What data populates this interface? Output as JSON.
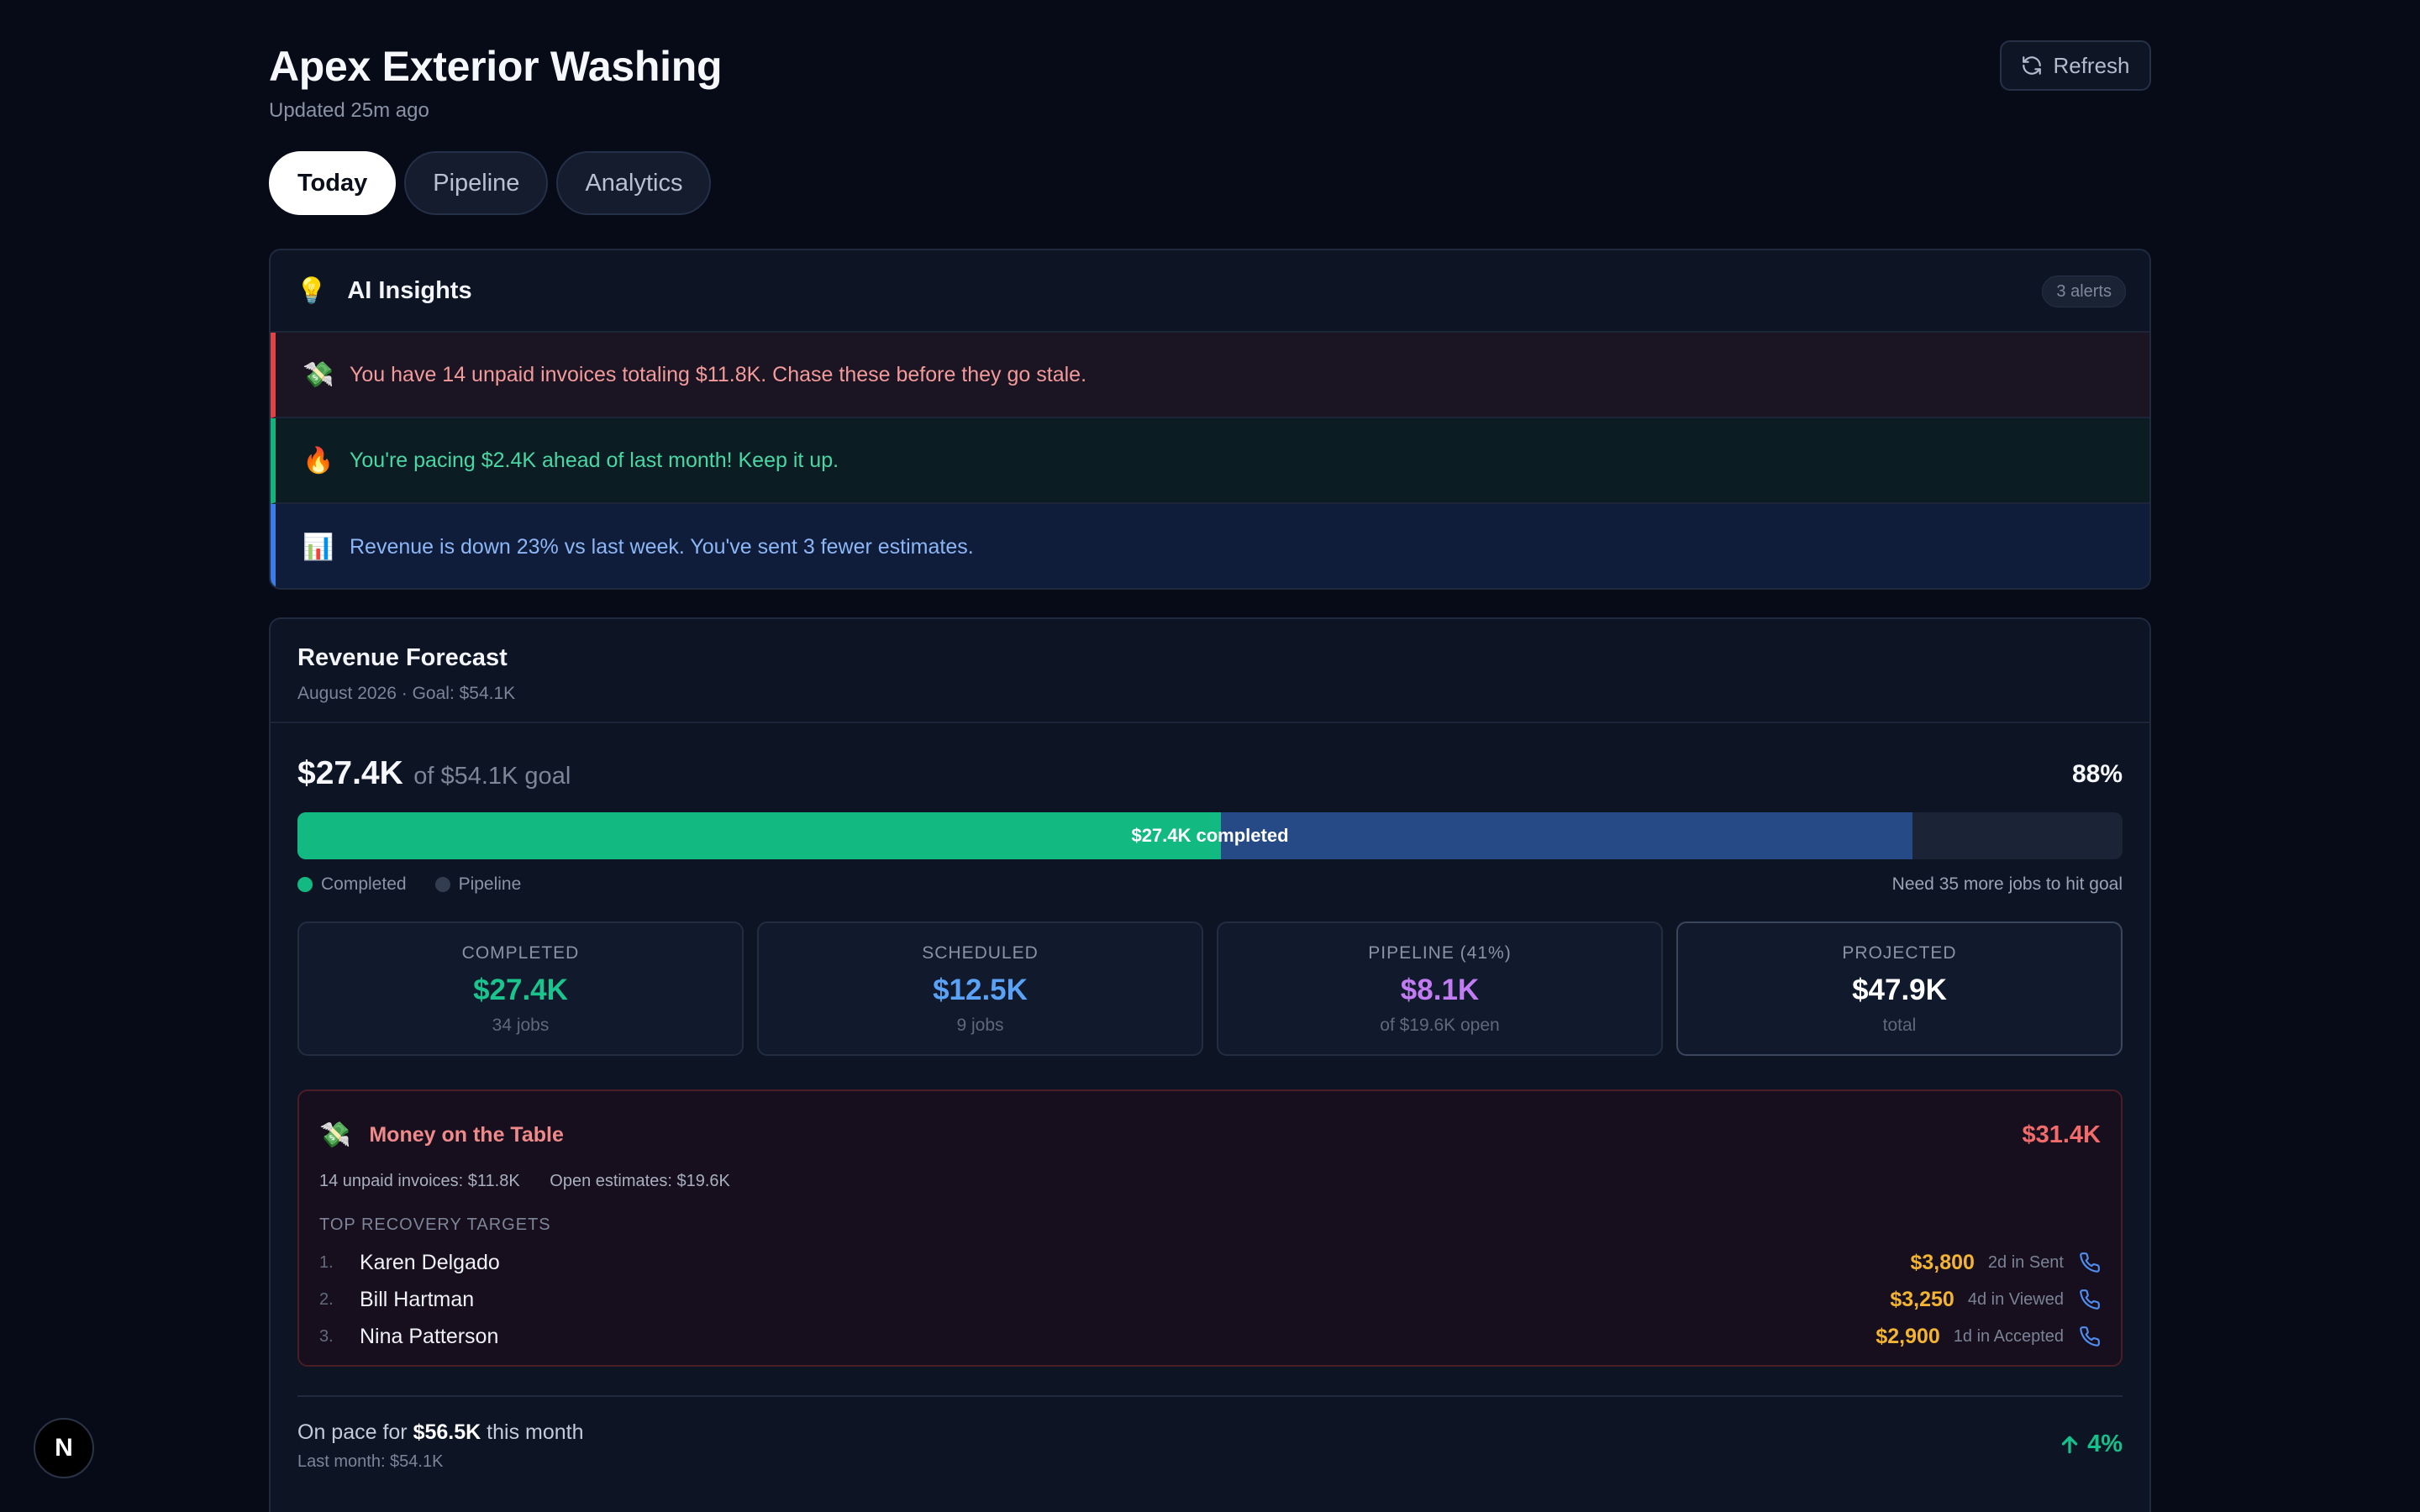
{
  "header": {
    "title": "Apex Exterior Washing",
    "updated": "Updated 25m ago",
    "refresh_label": "Refresh"
  },
  "tabs": [
    {
      "label": "Today",
      "active": true
    },
    {
      "label": "Pipeline",
      "active": false
    },
    {
      "label": "Analytics",
      "active": false
    }
  ],
  "insights": {
    "icon": "lightbulb",
    "title": "AI Insights",
    "badge": "3 alerts",
    "items": [
      {
        "icon": "💸",
        "text": "You have 14 unpaid invoices totaling $11.8K. Chase these before they go stale.",
        "tone": "red"
      },
      {
        "icon": "🔥",
        "text": "You're pacing $2.4K ahead of last month! Keep it up.",
        "tone": "green"
      },
      {
        "icon": "📊",
        "text": "Revenue is down 23% vs last week. You've sent 3 fewer estimates.",
        "tone": "blue"
      }
    ]
  },
  "forecast": {
    "title": "Revenue Forecast",
    "subtitle": "August 2026 · Goal: $54.1K",
    "amount": "$27.4K",
    "goal_text": "of $54.1K goal",
    "percent": "88%",
    "progress": {
      "completed_fraction": 0.506,
      "projected_fraction": 0.885
    },
    "bar_label": "$27.4K completed",
    "legend": {
      "completed": "Completed",
      "pipeline": "Pipeline",
      "need": "Need 35 more jobs to hit goal"
    },
    "stats": [
      {
        "label": "COMPLETED",
        "value": "$27.4K",
        "sub": "34 jobs",
        "color": "#19c58c"
      },
      {
        "label": "SCHEDULED",
        "value": "$12.5K",
        "sub": "9 jobs",
        "color": "#5aa2f5"
      },
      {
        "label": "PIPELINE (41%)",
        "value": "$8.1K",
        "sub": "of $19.6K open",
        "color": "#c07cf0"
      },
      {
        "label": "PROJECTED",
        "value": "$47.9K",
        "sub": "total",
        "color": "#ffffff"
      }
    ],
    "money": {
      "icon": "💸",
      "title": "Money on the Table",
      "total": "$31.4K",
      "unpaid": "14 unpaid invoices: $11.8K",
      "open": "Open estimates: $19.6K",
      "targets_label": "TOP RECOVERY TARGETS",
      "targets": [
        {
          "num": "1.",
          "name": "Karen Delgado",
          "amount": "$3,800",
          "stage": "2d in Sent"
        },
        {
          "num": "2.",
          "name": "Bill Hartman",
          "amount": "$3,250",
          "stage": "4d in Viewed"
        },
        {
          "num": "3.",
          "name": "Nina Patterson",
          "amount": "$2,900",
          "stage": "1d in Accepted"
        }
      ]
    },
    "pace": {
      "prefix": "On pace for",
      "amount": "$56.5K",
      "suffix": "this month",
      "last_month": "Last month: $54.1K",
      "growth": "4%"
    }
  },
  "colors": {
    "completed": "#12b981",
    "pipeline": "#264a85",
    "alert_red": "#e04343",
    "alert_green": "#14b37d",
    "alert_blue": "#3b7ce8"
  },
  "logo_letter": "N"
}
